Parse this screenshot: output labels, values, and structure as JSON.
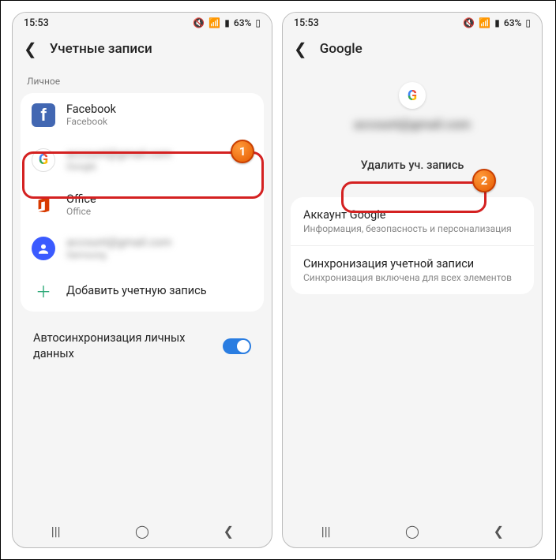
{
  "status": {
    "time": "15:53",
    "battery": "63%"
  },
  "phone1": {
    "title": "Учетные записи",
    "section": "Личное",
    "accounts": [
      {
        "title": "Facebook",
        "sub": "Facebook"
      },
      {
        "title": "account@gmail.com",
        "sub": "Google"
      },
      {
        "title": "Office",
        "sub": "Office"
      },
      {
        "title": "account@gmail.com",
        "sub": "Samsung"
      }
    ],
    "add_label": "Добавить учетную запись",
    "autosync_label": "Автосинхронизация личных данных"
  },
  "phone2": {
    "title": "Google",
    "email_masked": "account@gmail.com",
    "delete_label": "Удалить уч. запись",
    "items": [
      {
        "title": "Аккаунт Google",
        "sub": "Информация, безопасность и персонализация"
      },
      {
        "title": "Синхронизация учетной записи",
        "sub": "Синхронизация включена для всех элементов"
      }
    ]
  },
  "callouts": {
    "badge1": "1",
    "badge2": "2"
  }
}
